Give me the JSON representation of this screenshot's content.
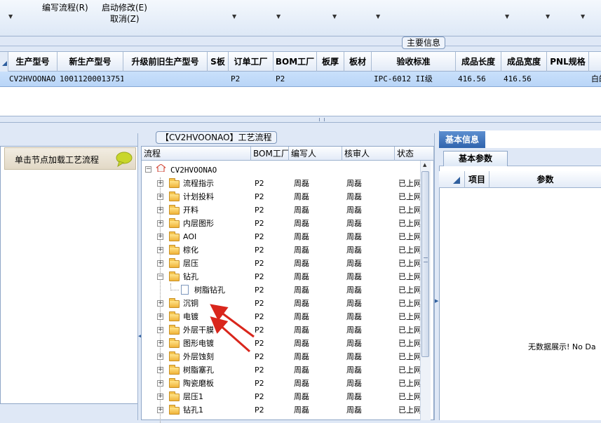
{
  "ribbon": {
    "edit_flow": "编写流程(R)",
    "start_modify": "启动修改(E)",
    "cancel": "取消(Z)"
  },
  "main_info_tab": "主要信息",
  "main_grid": {
    "columns": [
      "生产型号",
      "新生产型号",
      "升级前旧生产型号",
      "S板",
      "订单工厂",
      "BOM工厂",
      "板厚",
      "板材",
      "验收标准",
      "成品长度",
      "成品宽度",
      "PNL规格"
    ],
    "row": {
      "model": "CV2HVOONAO",
      "new_model": "10011200013751",
      "old_model": "",
      "s_board": "",
      "order_factory": "P2",
      "bom_factory": "P2",
      "thickness": "",
      "material": "",
      "standard": "IPC-6012 II级",
      "length": "416.56",
      "width": "416.56",
      "pnl": "",
      "extra": "白的"
    }
  },
  "left_panel": {
    "header": "单击节点加载工艺流程"
  },
  "flow_panel": {
    "title": "【CV2HVOONAO】工艺流程",
    "columns": [
      "流程",
      "BOM工厂",
      "编写人",
      "核审人",
      "状态"
    ],
    "root": "CV2HVOONAO",
    "rows": [
      {
        "name": "流程指示",
        "factory": "P2",
        "author": "周磊",
        "reviewer": "周磊",
        "status": "已上网"
      },
      {
        "name": "计划投料",
        "factory": "P2",
        "author": "周磊",
        "reviewer": "周磊",
        "status": "已上网"
      },
      {
        "name": "开料",
        "factory": "P2",
        "author": "周磊",
        "reviewer": "周磊",
        "status": "已上网"
      },
      {
        "name": "内层图形",
        "factory": "P2",
        "author": "周磊",
        "reviewer": "周磊",
        "status": "已上网"
      },
      {
        "name": "AOI",
        "factory": "P2",
        "author": "周磊",
        "reviewer": "周磊",
        "status": "已上网"
      },
      {
        "name": "棕化",
        "factory": "P2",
        "author": "周磊",
        "reviewer": "周磊",
        "status": "已上网"
      },
      {
        "name": "层压",
        "factory": "P2",
        "author": "周磊",
        "reviewer": "周磊",
        "status": "已上网"
      },
      {
        "name": "钻孔",
        "factory": "P2",
        "author": "周磊",
        "reviewer": "周磊",
        "status": "已上网"
      },
      {
        "name": "树脂钻孔",
        "factory": "P2",
        "author": "周磊",
        "reviewer": "周磊",
        "status": "已上网"
      },
      {
        "name": "沉铜",
        "factory": "P2",
        "author": "周磊",
        "reviewer": "周磊",
        "status": "已上网"
      },
      {
        "name": "电镀",
        "factory": "P2",
        "author": "周磊",
        "reviewer": "周磊",
        "status": "已上网"
      },
      {
        "name": "外层干膜",
        "factory": "P2",
        "author": "周磊",
        "reviewer": "周磊",
        "status": "已上网"
      },
      {
        "name": "图形电镀",
        "factory": "P2",
        "author": "周磊",
        "reviewer": "周磊",
        "status": "已上网"
      },
      {
        "name": "外层蚀刻",
        "factory": "P2",
        "author": "周磊",
        "reviewer": "周磊",
        "status": "已上网"
      },
      {
        "name": "树脂塞孔",
        "factory": "P2",
        "author": "周磊",
        "reviewer": "周磊",
        "status": "已上网"
      },
      {
        "name": "陶瓷磨板",
        "factory": "P2",
        "author": "周磊",
        "reviewer": "周磊",
        "status": "已上网"
      },
      {
        "name": "层压1",
        "factory": "P2",
        "author": "周磊",
        "reviewer": "周磊",
        "status": "已上网"
      },
      {
        "name": "钻孔1",
        "factory": "P2",
        "author": "周磊",
        "reviewer": "周磊",
        "status": "已上网"
      }
    ]
  },
  "right_panel": {
    "tab": "基本信息",
    "subtab": "基本参数",
    "columns": [
      "项目",
      "参数"
    ],
    "empty": "无数据展示! No Da"
  },
  "colors": {
    "selected_row": "#c9e0fb",
    "tab_blue": "#2f63ad",
    "arrow_red": "#d9261c"
  }
}
